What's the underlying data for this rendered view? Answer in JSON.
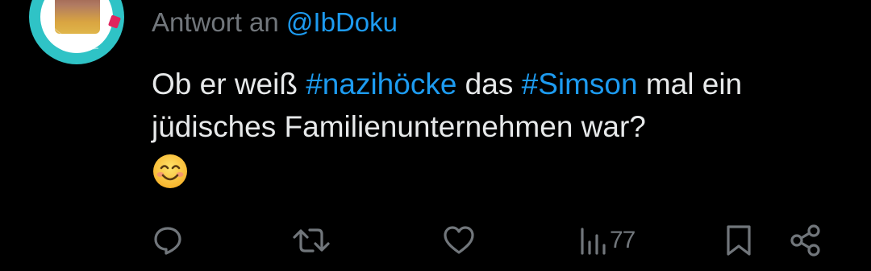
{
  "reply": {
    "prefix": "Antwort an",
    "mention": "@IbDoku"
  },
  "post": {
    "text_1": "Ob er weiß ",
    "tag_1": "#nazihöcke",
    "text_2": " das ",
    "tag_2": "#Simson",
    "text_3": " mal ein  jüdisches Familienunternehmen war?",
    "emoji": "smiling-face-with-smiling-eyes"
  },
  "actions": {
    "views_count": "77"
  },
  "icons": {
    "reply": "reply-icon",
    "repost": "repost-icon",
    "like": "like-icon",
    "views": "views-icon",
    "bookmark": "bookmark-icon",
    "share": "share-icon"
  },
  "colors": {
    "background": "#000000",
    "text": "#e7e9ea",
    "muted": "#71767b",
    "link": "#1d9bf0",
    "avatar_ring": "#2fc3c6"
  }
}
